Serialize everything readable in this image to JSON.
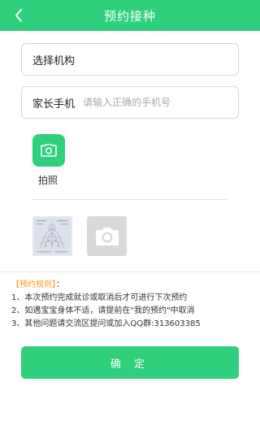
{
  "header": {
    "title": "预约接种",
    "back_icon": "chevron-left-icon",
    "background": "#2fcf7c"
  },
  "form": {
    "organization_label": "选择机构",
    "phone_label": "家长手机",
    "phone_placeholder": "请输入正确的手机号",
    "phone_value": ""
  },
  "photo": {
    "icon": "camera-icon",
    "label": "拍照"
  },
  "uploads": {
    "thumbnail": "uploaded-photo",
    "add_icon": "camera-icon"
  },
  "rules": {
    "title": "【预约规则】",
    "title_suffix": "：",
    "items": [
      "1、本次预约完成就诊或取消后才可进行下次预约",
      "2、如遇宝宝身体不适，请提前在\"我的预约\"中取消",
      "3、其他问题请交流区提问或加入QQ群:313603385"
    ],
    "title_color": "#f39b1f"
  },
  "actions": {
    "confirm_label": "确 定"
  }
}
